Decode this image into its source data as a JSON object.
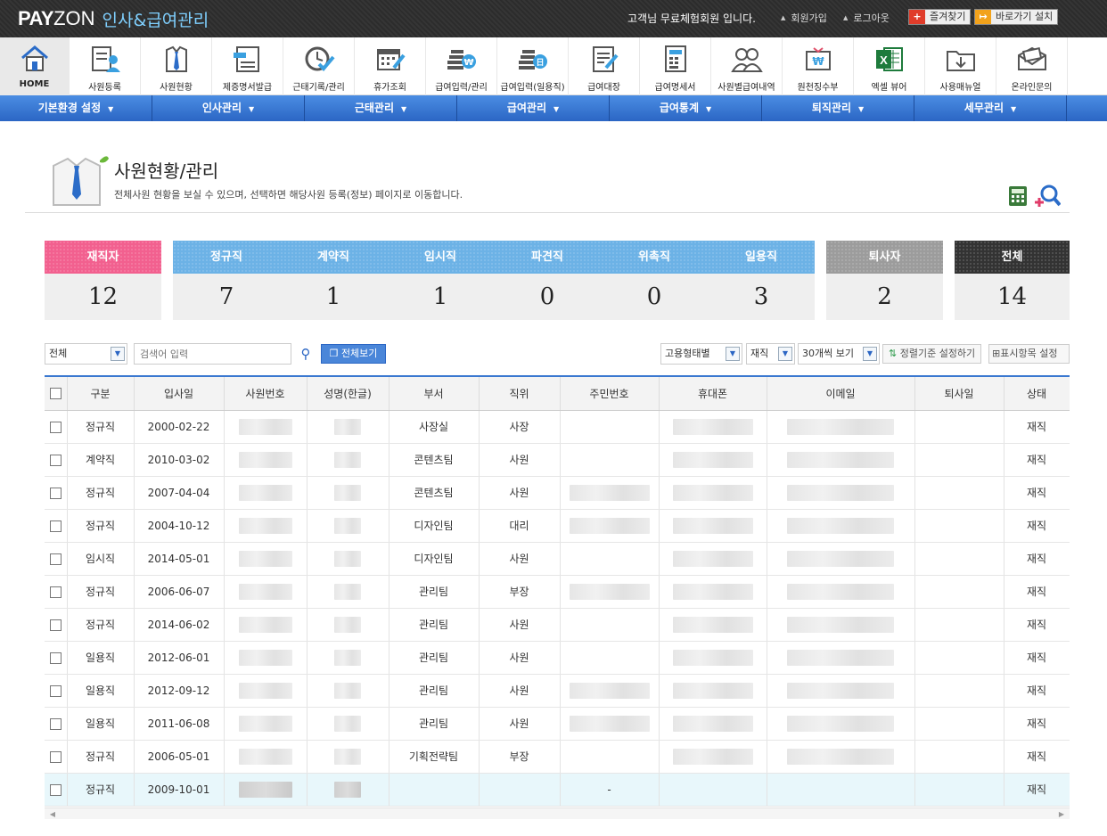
{
  "header": {
    "logo_brand": "PAY",
    "logo_brand2": "ZON",
    "logo_sub": "인사&급여관리",
    "greeting": "고객님 무료체험회원 입니다.",
    "join": "회원가입",
    "logout": "로그아웃",
    "bookmark": "즐겨찾기",
    "shortcut": "바로가기 설치"
  },
  "icon_nav": [
    {
      "label": "HOME",
      "icon": "home-icon"
    },
    {
      "label": "사원등록",
      "icon": "employee-register-icon"
    },
    {
      "label": "사원현황",
      "icon": "employee-status-icon"
    },
    {
      "label": "제증명서발급",
      "icon": "certificate-icon"
    },
    {
      "label": "근태기록/관리",
      "icon": "attendance-clock-icon"
    },
    {
      "label": "휴가조회",
      "icon": "calendar-icon"
    },
    {
      "label": "급여입력/관리",
      "icon": "payroll-input-icon"
    },
    {
      "label": "급여입력(일용직)",
      "icon": "daily-payroll-icon"
    },
    {
      "label": "급여대장",
      "icon": "payroll-ledger-icon"
    },
    {
      "label": "급여명세서",
      "icon": "payslip-icon"
    },
    {
      "label": "사원별급여내역",
      "icon": "employees-pay-icon"
    },
    {
      "label": "원천징수부",
      "icon": "withholding-icon"
    },
    {
      "label": "엑셀 뷰어",
      "icon": "excel-icon"
    },
    {
      "label": "사용매뉴얼",
      "icon": "manual-download-icon"
    },
    {
      "label": "온라인문의",
      "icon": "online-inquiry-icon"
    }
  ],
  "menu": [
    "기본환경 설정",
    "인사관리",
    "근태관리",
    "급여관리",
    "급여통계",
    "퇴직관리",
    "세무관리"
  ],
  "page": {
    "title": "사원현황/관리",
    "description": "전체사원 현황을 보실 수 있으며, 선택하면 해당사원 등록(정보) 페이지로 이동합니다."
  },
  "stats": {
    "active": {
      "label": "재직자",
      "value": "12"
    },
    "types": [
      {
        "label": "정규직",
        "value": "7"
      },
      {
        "label": "계약직",
        "value": "1"
      },
      {
        "label": "임시직",
        "value": "1"
      },
      {
        "label": "파견직",
        "value": "0"
      },
      {
        "label": "위촉직",
        "value": "0"
      },
      {
        "label": "일용직",
        "value": "3"
      }
    ],
    "retired": {
      "label": "퇴사자",
      "value": "2"
    },
    "total": {
      "label": "전체",
      "value": "14"
    }
  },
  "toolbar": {
    "filter": "전체",
    "search_placeholder": "검색어 입력",
    "view_all": "전체보기",
    "employment_filter": "고용형태별",
    "status_filter": "재직",
    "page_size": "30개씩 보기",
    "sort_setting": "정렬기준 설정하기",
    "column_setting": "표시항목 설정"
  },
  "colors": {
    "accent": "#3a78d0",
    "active": "#f2608f",
    "types": "#6cb2e6",
    "retired": "#9c9c9c",
    "total": "#333333"
  },
  "table": {
    "columns": [
      "구분",
      "입사일",
      "사원번호",
      "성명(한글)",
      "부서",
      "직위",
      "주민번호",
      "휴대폰",
      "이메일",
      "퇴사일",
      "상태"
    ],
    "rows": [
      {
        "type": "정규직",
        "date": "2000-02-22",
        "dept": "사장실",
        "position": "사장",
        "ssn": "",
        "status": "재직"
      },
      {
        "type": "계약직",
        "date": "2010-03-02",
        "dept": "콘텐츠팀",
        "position": "사원",
        "ssn": "",
        "status": "재직"
      },
      {
        "type": "정규직",
        "date": "2007-04-04",
        "dept": "콘텐츠팀",
        "position": "사원",
        "ssn": "",
        "status": "재직"
      },
      {
        "type": "정규직",
        "date": "2004-10-12",
        "dept": "디자인팀",
        "position": "대리",
        "ssn": "",
        "status": "재직"
      },
      {
        "type": "임시직",
        "date": "2014-05-01",
        "dept": "디자인팀",
        "position": "사원",
        "ssn": "",
        "status": "재직"
      },
      {
        "type": "정규직",
        "date": "2006-06-07",
        "dept": "관리팀",
        "position": "부장",
        "ssn": "",
        "status": "재직"
      },
      {
        "type": "정규직",
        "date": "2014-06-02",
        "dept": "관리팀",
        "position": "사원",
        "ssn": "",
        "status": "재직"
      },
      {
        "type": "일용직",
        "date": "2012-06-01",
        "dept": "관리팀",
        "position": "사원",
        "ssn": "",
        "status": "재직"
      },
      {
        "type": "일용직",
        "date": "2012-09-12",
        "dept": "관리팀",
        "position": "사원",
        "ssn": "",
        "status": "재직"
      },
      {
        "type": "일용직",
        "date": "2011-06-08",
        "dept": "관리팀",
        "position": "사원",
        "ssn": "",
        "status": "재직"
      },
      {
        "type": "정규직",
        "date": "2006-05-01",
        "dept": "기획전략팀",
        "position": "부장",
        "ssn": "",
        "status": "재직"
      },
      {
        "type": "정규직",
        "date": "2009-10-01",
        "dept": "",
        "position": "",
        "ssn": "-",
        "status": "재직"
      }
    ]
  }
}
